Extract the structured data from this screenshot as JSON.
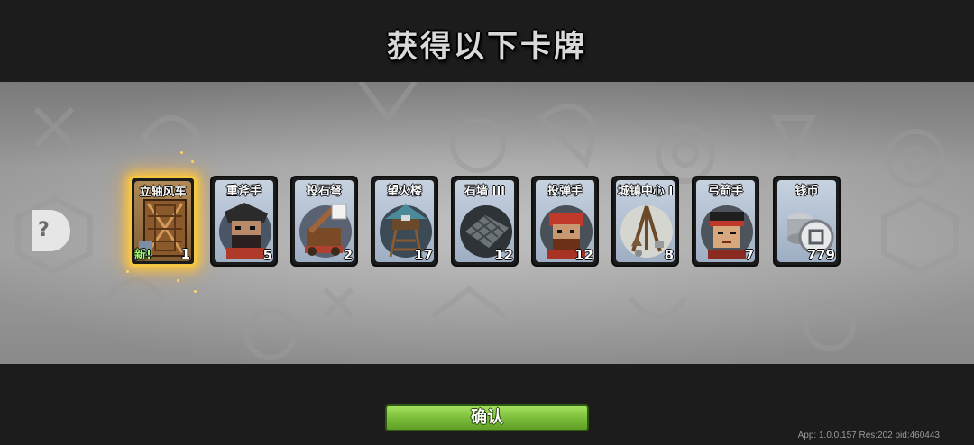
{
  "header": {
    "title": "获得以下卡牌"
  },
  "cards": [
    {
      "name": "立轴风车",
      "count": "1",
      "new_label": "新!",
      "icon": "windmill-icon"
    },
    {
      "name": "重斧手",
      "count": "5",
      "icon": "axeman-icon"
    },
    {
      "name": "投石弩",
      "count": "2",
      "icon": "catapult-icon"
    },
    {
      "name": "望火楼",
      "count": "17",
      "icon": "watchtower-icon"
    },
    {
      "name": "石墙 III",
      "count": "12",
      "icon": "stone-wall-icon"
    },
    {
      "name": "投弹手",
      "count": "12",
      "icon": "bomber-icon"
    },
    {
      "name": "城镇中心 I",
      "count": "8",
      "icon": "town-center-icon"
    },
    {
      "name": "弓箭手",
      "count": "7",
      "icon": "archer-icon"
    },
    {
      "name": "钱币",
      "count": "779",
      "icon": "coin-icon"
    }
  ],
  "side_badge": {
    "icon": "exit-icon",
    "glyph": "?"
  },
  "footer": {
    "confirm_label": "确认",
    "version": "App: 1.0.0.157 Res:202 pid:460443"
  },
  "colors": {
    "highlight": "#f3c742",
    "confirm": "#7cbe3b",
    "new": "#9dfa6a"
  }
}
